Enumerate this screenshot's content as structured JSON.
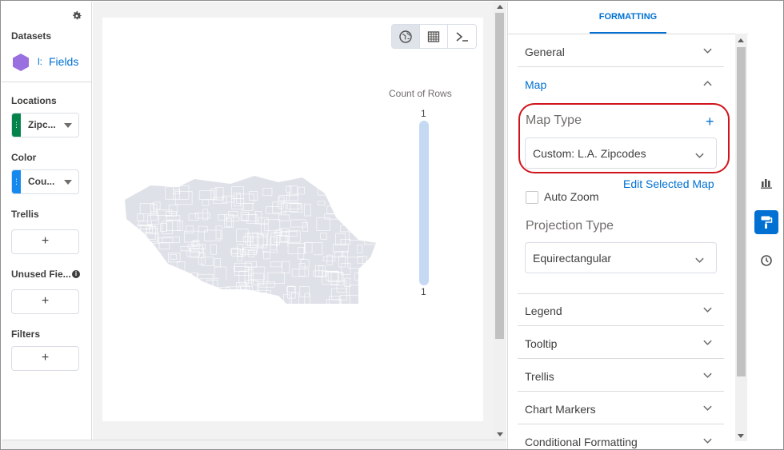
{
  "left_panel": {
    "datasets_label": "Datasets",
    "dataset_truncated": "l:",
    "fields_link": "Fields",
    "locations_label": "Locations",
    "locations_pill": "Zipc...",
    "color_label": "Color",
    "color_pill": "Cou...",
    "trellis_label": "Trellis",
    "unused_fields_label": "Unused Fie...",
    "filters_label": "Filters",
    "add_symbol": "+",
    "info_symbol": "i",
    "pill_handle": "⋮"
  },
  "canvas": {
    "legend_title": "Count of Rows",
    "legend_max": "1",
    "legend_min": "1",
    "legend_color": "#c5d9f3",
    "map_fill_color": "#dfe1e8",
    "view_buttons": [
      "globe-icon",
      "table-icon",
      "console-icon"
    ],
    "active_view": "globe-icon"
  },
  "formatting": {
    "tab_label": "FORMATTING",
    "sections": {
      "general": "General",
      "map": "Map",
      "legend": "Legend",
      "tooltip": "Tooltip",
      "trellis": "Trellis",
      "chart_markers": "Chart Markers",
      "conditional_formatting": "Conditional Formatting"
    },
    "map_type_label": "Map Type",
    "map_type_add": "+",
    "map_type_value": "Custom: L.A. Zipcodes",
    "edit_selected_map": "Edit Selected Map",
    "auto_zoom_label": "Auto Zoom",
    "auto_zoom_checked": false,
    "projection_label": "Projection Type",
    "projection_value": "Equirectangular"
  },
  "toolbar": {
    "items": [
      "bar-chart-icon",
      "paint-roller-icon",
      "clock-icon"
    ],
    "active": "paint-roller-icon"
  },
  "colors": {
    "accent": "#0070d2",
    "highlight_ring": "#d0141c",
    "location_pill_bar": "#04844b",
    "color_pill_bar": "#1589ee",
    "dataset_icon": "#9a6fe0"
  }
}
